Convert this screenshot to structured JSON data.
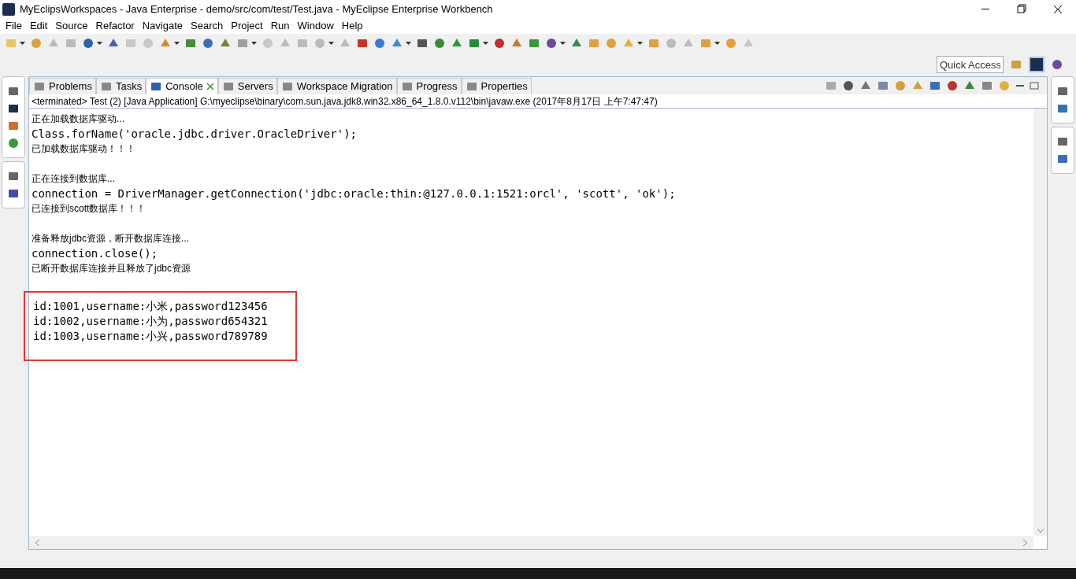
{
  "window": {
    "title": "MyEclipsWorkspaces - Java Enterprise - demo/src/com/test/Test.java - MyEclipse Enterprise Workbench"
  },
  "menu": [
    "File",
    "Edit",
    "Source",
    "Refactor",
    "Navigate",
    "Search",
    "Project",
    "Run",
    "Window",
    "Help"
  ],
  "quick_access": {
    "placeholder": "Quick Access"
  },
  "tabs": [
    {
      "label": "Problems",
      "selected": false
    },
    {
      "label": "Tasks",
      "selected": false
    },
    {
      "label": "Console",
      "selected": true
    },
    {
      "label": "Servers",
      "selected": false
    },
    {
      "label": "Workspace Migration",
      "selected": false
    },
    {
      "label": "Progress",
      "selected": false
    },
    {
      "label": "Properties",
      "selected": false
    }
  ],
  "console": {
    "status": "<terminated> Test (2) [Java Application] G:\\myeclipse\\binary\\com.sun.java.jdk8.win32.x86_64_1.8.0.v112\\bin\\javaw.exe (2017年8月17日 上午7:47:47)",
    "blocks": [
      {
        "highlighted": false,
        "lines": [
          {
            "kind": "message",
            "text": "正在加载数据库驱动..."
          },
          {
            "kind": "code",
            "text": "Class.forName('oracle.jdbc.driver.OracleDriver');"
          },
          {
            "kind": "message",
            "text": "已加载数据库驱动！！！"
          }
        ]
      },
      {
        "highlighted": false,
        "lines": [
          {
            "kind": "message",
            "text": "正在连接到数据库..."
          },
          {
            "kind": "code",
            "text": "connection = DriverManager.getConnection('jdbc:oracle:thin:@127.0.0.1:1521:orcl', 'scott', 'ok');"
          },
          {
            "kind": "message",
            "text": "已连接到scott数据库！！！"
          }
        ]
      },
      {
        "highlighted": false,
        "lines": [
          {
            "kind": "message",
            "text": "准备释放jdbc资源，断开数据库连接..."
          },
          {
            "kind": "code",
            "text": "connection.close();"
          },
          {
            "kind": "message",
            "text": "已断开数据库连接并且释放了jdbc资源"
          }
        ]
      },
      {
        "highlighted": true,
        "lines": [
          {
            "kind": "code",
            "text": "id:1001,username:小米,password123456"
          },
          {
            "kind": "code",
            "text": "id:1002,username:小为,password654321"
          },
          {
            "kind": "code",
            "text": "id:1003,username:小兴,password789789"
          }
        ]
      }
    ]
  }
}
